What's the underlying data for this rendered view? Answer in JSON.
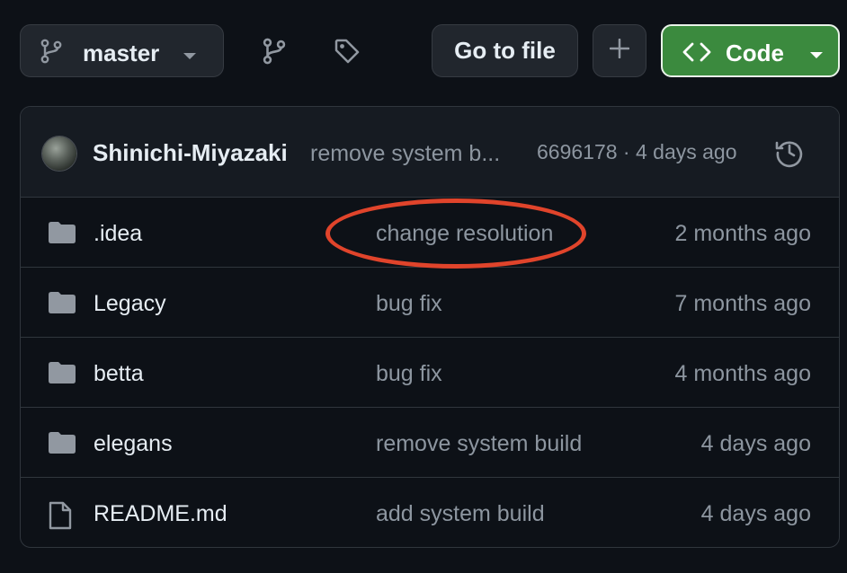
{
  "toolbar": {
    "branch_label": "master",
    "branch_icon": "git-branch-icon",
    "branches_icon": "git-branch-icon",
    "tags_icon": "tag-icon",
    "goto_label": "Go to file",
    "add_icon": "plus-icon",
    "code_label": "Code",
    "code_icon": "code-brackets-icon"
  },
  "latest_commit": {
    "author": "Shinichi-Miyazaki",
    "message": "remove system b...",
    "meta": "6696178 · 4 days ago",
    "history_icon": "history-icon"
  },
  "files": [
    {
      "name": ".idea",
      "icon": "folder-icon",
      "message": "change resolution",
      "age": "2 months ago"
    },
    {
      "name": "Legacy",
      "icon": "folder-icon",
      "message": "bug fix",
      "age": "7 months ago"
    },
    {
      "name": "betta",
      "icon": "folder-icon",
      "message": "bug fix",
      "age": "4 months ago"
    },
    {
      "name": "elegans",
      "icon": "folder-icon",
      "message": "remove system build",
      "age": "4 days ago"
    },
    {
      "name": "README.md",
      "icon": "file-icon",
      "message": "add system build",
      "age": "4 days ago"
    }
  ],
  "colors": {
    "background": "#0d1117",
    "code_button": "#3b8a3e",
    "annotation": "#e0442b"
  }
}
